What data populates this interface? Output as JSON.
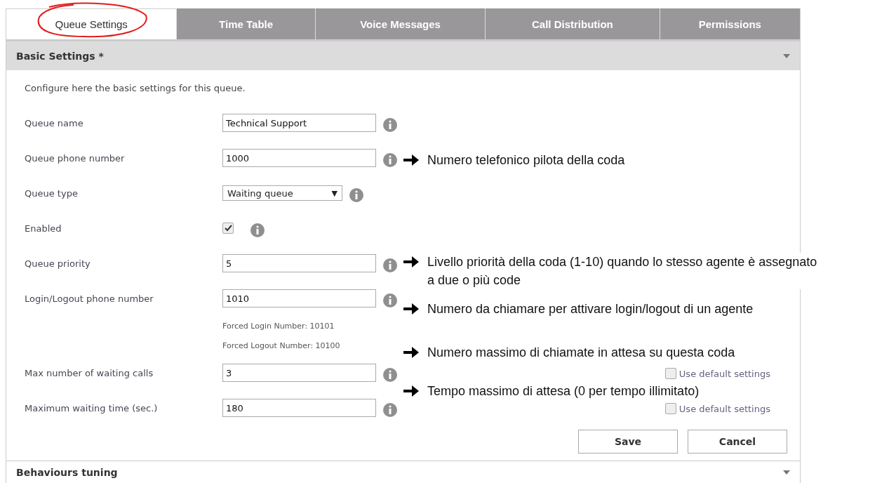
{
  "tabs": [
    {
      "label": "Queue Settings",
      "selected": true
    },
    {
      "label": "Time Table",
      "selected": false
    },
    {
      "label": "Voice Messages",
      "selected": false
    },
    {
      "label": "Call Distribution",
      "selected": false
    },
    {
      "label": "Permissions",
      "selected": false
    }
  ],
  "sections": [
    {
      "title": "Basic Settings *",
      "expanded": true,
      "intro": "Configure here the basic settings for this queue.",
      "fields": [
        {
          "label": "Queue name",
          "kind": "text",
          "value": "Technical Support"
        },
        {
          "label": "Queue phone number",
          "kind": "text",
          "value": "1000"
        },
        {
          "label": "Queue type",
          "kind": "select",
          "value": "Waiting queue",
          "caret": "▼"
        },
        {
          "label": "Enabled",
          "kind": "checkbox",
          "checked": true
        },
        {
          "label": "Queue priority",
          "kind": "text",
          "value": "5"
        },
        {
          "label": "Login/Logout phone number",
          "kind": "text",
          "value": "1010",
          "hints": [
            "Forced Login Number: 10101",
            "Forced Logout Number: 10100"
          ]
        },
        {
          "label": "Max number of waiting calls",
          "kind": "text",
          "value": "3",
          "use_default": {
            "label": "Use default settings",
            "checked": false
          }
        },
        {
          "label": "Maximum waiting time (sec.)",
          "kind": "text",
          "value": "180",
          "use_default": {
            "label": "Use default settings",
            "checked": false
          }
        }
      ],
      "buttons": [
        "Save",
        "Cancel"
      ]
    },
    {
      "title": "Behaviours tuning",
      "expanded": false
    }
  ],
  "annotations": [
    {
      "text": "Numero telefonico pilota della coda"
    },
    {
      "text": "Livello priorità della coda (1-10) quando lo stesso agente è assegnato a due o più code"
    },
    {
      "text": "Numero da chiamare per attivare login/logout di un agente"
    },
    {
      "text": "Numero massimo di chiamate in attesa su questa coda"
    },
    {
      "text": "Tempo massimo di attesa (0 per tempo illimitato)"
    }
  ]
}
